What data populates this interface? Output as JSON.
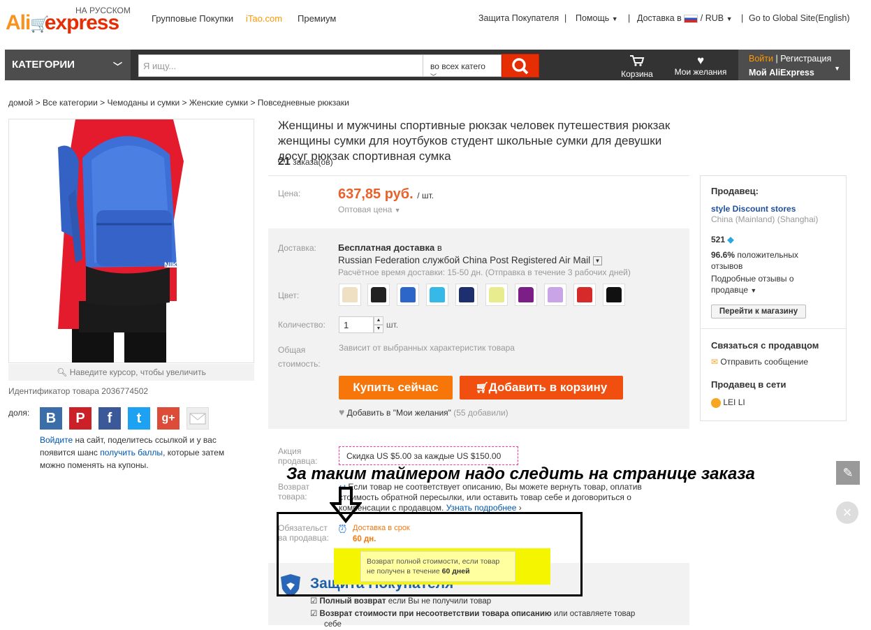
{
  "header": {
    "logo_ali": "Ali",
    "logo_express": "express",
    "logo_sub": "НА РУССКОМ",
    "nav": [
      "Групповые Покупки",
      "iTao.com",
      "Премиум"
    ],
    "buyer_protection": "Защита Покупателя",
    "help": "Помощь",
    "delivery_to": "Доставка в",
    "currency": "/ RUB",
    "global_site": "Go to Global Site(English)"
  },
  "navbar": {
    "categories": "КАТЕГОРИИ",
    "search_placeholder": "Я ищу...",
    "search_category": "во всех катего",
    "cart": "Корзина",
    "wishlist": "Мои желания",
    "login": "Войти",
    "register": "Регистрация",
    "my_account": "Мой AliExpress"
  },
  "breadcrumb": "домой > Все категории > Чемоданы и сумки > Женские сумки > Повседневные рюкзаки",
  "gallery": {
    "zoom_hint": "Наведите курсор, чтобы увеличить",
    "product_id": "Идентификатор товара 2036774502",
    "share_label": "доля:",
    "share_text_1": "Войдите",
    "share_text_2": " на сайт, поделитесь ссылкой и у вас появится шанс ",
    "share_text_3": "получить баллы",
    "share_text_4": ", которые затем можно поменять на купоны."
  },
  "social": [
    {
      "name": "vk",
      "glyph": "B",
      "color": "#3b6ea8"
    },
    {
      "name": "pinterest",
      "glyph": "P",
      "color": "#cb2027"
    },
    {
      "name": "facebook",
      "glyph": "f",
      "color": "#3b5998"
    },
    {
      "name": "twitter",
      "glyph": "t",
      "color": "#1da1f2"
    },
    {
      "name": "google-plus",
      "glyph": "g+",
      "color": "#dd4b39"
    },
    {
      "name": "email",
      "glyph": "",
      "color": "#e8e8e8"
    }
  ],
  "product": {
    "title": "Женщины и мужчины спортивные рюкзак человек путешествия рюкзак женщины сумки для ноутбуков студент школьные сумки для девушки досуг рюкзак спортивная сумка",
    "orders_count": "21",
    "orders_label": "заказа(ов)",
    "price_label": "Цена:",
    "price": "637,85 руб.",
    "price_unit": "/ шт.",
    "wholesale": "Оптовая цена",
    "delivery_label": "Доставка:",
    "delivery_free": "Бесплатная доставка",
    "delivery_in": "в",
    "delivery_service": "Russian Federation службой China Post Registered Air Mail",
    "delivery_time": "Расчётное время доставки: 15-50 дн. (Отправка в течение 3 рабочих дней)",
    "color_label": "Цвет:",
    "colors": [
      "#efe0c4",
      "#222222",
      "#2d66c9",
      "#37b9e8",
      "#1d2f6e",
      "#e8ec8f",
      "#7b1f86",
      "#c9a4e6",
      "#d62a2a",
      "#111111"
    ],
    "qty_label": "Количество:",
    "qty_value": "1",
    "qty_unit": "шт.",
    "total_label_1": "Общая",
    "total_label_2": "стоимость:",
    "total_value": "Зависит от выбранных характеристик товара",
    "buy_now": "Купить сейчас",
    "add_to_cart": "Добавить в корзину",
    "wishlist_add": "Добавить в \"Мои желания\"",
    "wishlist_count": "(55 добавили)",
    "promo_label_1": "Акция",
    "promo_label_2": "продавца:",
    "promo_text": "Скидка US $5.00 за каждые US $150.00",
    "return_label_1": "Возврат",
    "return_label_2": "товара:",
    "return_text_1": "Если товар не соответствует описанию, Вы можете вернуть товар, оплатив",
    "return_text_2": "стоимость обратной пересылки, или оставить товар себе и договориться о",
    "return_text_3": "компенсации с продавцом.",
    "return_more": "Узнать подробнее",
    "oblig_label_1": "Обязательст",
    "oblig_label_2": "ва продавца:",
    "ontime": "Доставка в срок",
    "ontime_days": "60 дн.",
    "tooltip_1": "Возврат полной стоимости, если товар",
    "tooltip_2": "не получен в течение",
    "tooltip_days": "60 дней",
    "protection_title": "Защита Покупателя",
    "protection_1_bold": "Полный возврат",
    "protection_1_rest": "если Вы не получили товар",
    "protection_2_bold": "Возврат стоимости при несоответствии товара описанию",
    "protection_2_rest": "или оставляете товар",
    "protection_2_cont": "себе"
  },
  "annotation": "За таким таймером надо следить на странице заказа",
  "seller": {
    "heading": "Продавец:",
    "store": "style Discount stores",
    "location": "China (Mainland) (Shanghai)",
    "score": "521",
    "positive_pct": "96.6%",
    "positive_text_1": "положительных",
    "positive_text_2": "отзывов",
    "details_1": "Подробные отзывы о",
    "details_2": "продавце",
    "visit_store": "Перейти к магазину",
    "contact_heading": "Связаться с продавцом",
    "send_message": "Отправить сообщение",
    "online_heading": "Продавец в сети",
    "online_name": "LEI LI"
  }
}
